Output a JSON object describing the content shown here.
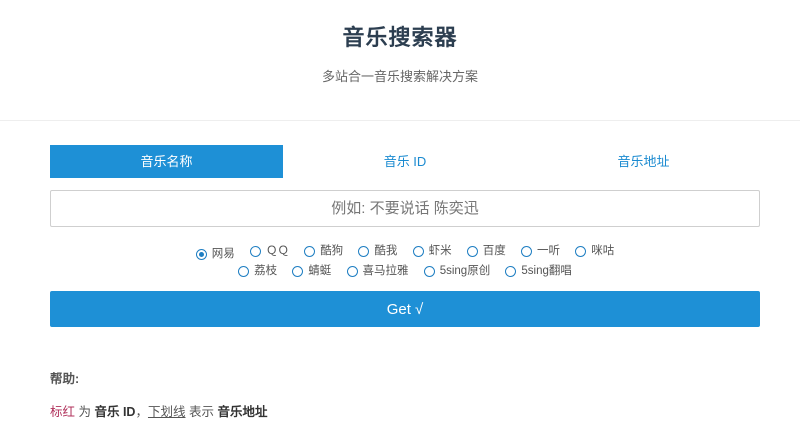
{
  "header": {
    "title": "音乐搜索器",
    "subtitle": "多站合一音乐搜索解决方案"
  },
  "tabs": [
    {
      "label": "音乐名称",
      "active": true
    },
    {
      "label": "音乐 ID",
      "active": false
    },
    {
      "label": "音乐地址",
      "active": false
    }
  ],
  "search": {
    "placeholder": "例如: 不要说话 陈奕迅",
    "value": ""
  },
  "sources": {
    "selected": "网易",
    "row1": [
      "网易",
      "ＱＱ",
      "酷狗",
      "酷我",
      "虾米",
      "百度",
      "一听",
      "咪咕"
    ],
    "row2": [
      "荔枝",
      "蜻蜓",
      "喜马拉雅",
      "5sing原创",
      "5sing翻唱"
    ]
  },
  "get_button": {
    "label": "Get √"
  },
  "help": {
    "title": "帮助:",
    "red_text": "标红",
    "t1": " 为 ",
    "music_id": "音乐 ID",
    "t2": "，",
    "underline_text": "下划线",
    "t3": " 表示 ",
    "music_url": "音乐地址"
  },
  "colors": {
    "accent": "#1e90d6",
    "highlight_red": "#b0315b",
    "title": "#2c3e50"
  }
}
